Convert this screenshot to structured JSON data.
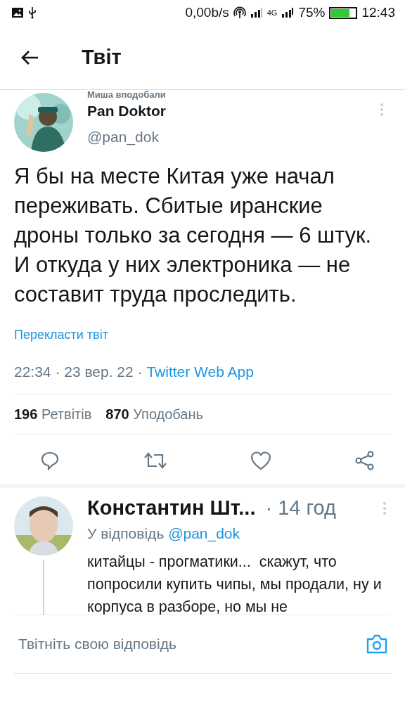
{
  "status_bar": {
    "speed": "0,00b/s",
    "network": "4G",
    "battery": "75%",
    "time": "12:43"
  },
  "header": {
    "title": "Твіт"
  },
  "tweet": {
    "social_context": "Миша вподобали",
    "name": "Pan Doktor",
    "handle": "@pan_dok",
    "text": "Я бы на месте Китая уже начал переживать. Сбитые иранские дроны только за сегодня — 6 штук. И откуда у них электроника — не составит труда проследить.",
    "translate": "Перекласти твіт",
    "time": "22:34 · 23 вер. 22 · ",
    "source": "Twitter Web App",
    "stats": [
      {
        "count": "196",
        "label": "Ретвітів"
      },
      {
        "count": "870",
        "label": "Уподобань"
      }
    ]
  },
  "reply": {
    "name": "Константин Шт...",
    "time": "· 14 год",
    "replying_to": "У відповідь ",
    "mention": "@pan_dok",
    "text": "китайцы - прогматики...  скажут, что попросили купить чипы, мы продали, ну и корпуса в разборе, но мы не"
  },
  "composer": {
    "placeholder": "Твітніть свою відповідь"
  }
}
